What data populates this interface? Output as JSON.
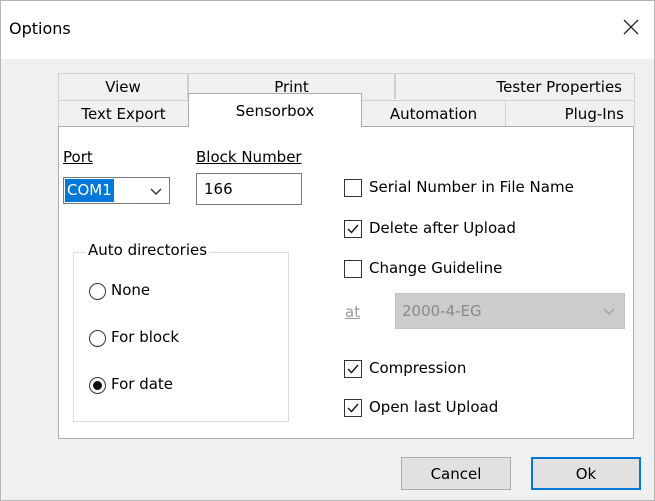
{
  "window": {
    "title": "Options"
  },
  "tabs": {
    "row_top": [
      {
        "label": "View"
      },
      {
        "label": "Print"
      },
      {
        "label": "Tester Properties"
      }
    ],
    "row_bottom": [
      {
        "label": "Text Export"
      },
      {
        "label": "Sensorbox",
        "active": true
      },
      {
        "label": "Automation"
      },
      {
        "label": "Plug-Ins"
      }
    ]
  },
  "sensorbox": {
    "port_label": "Port",
    "port_value": "COM1",
    "block_number_label": "Block Number",
    "block_number_value": "166",
    "auto_directories": {
      "title": "Auto directories",
      "options": [
        {
          "label": "None",
          "selected": false
        },
        {
          "label": "For block",
          "selected": false
        },
        {
          "label": "For date",
          "selected": true
        }
      ]
    },
    "checkboxes": [
      {
        "label": "Serial Number in File Name",
        "checked": false
      },
      {
        "label": "Delete after Upload",
        "checked": true
      },
      {
        "label": "Change Guideline",
        "checked": false
      },
      {
        "label": "Compression",
        "checked": true
      },
      {
        "label": "Open last Upload",
        "checked": true
      }
    ],
    "guideline": {
      "at_label": "at",
      "value": "2000-4-EG"
    }
  },
  "buttons": {
    "cancel": "Cancel",
    "ok": "Ok"
  }
}
